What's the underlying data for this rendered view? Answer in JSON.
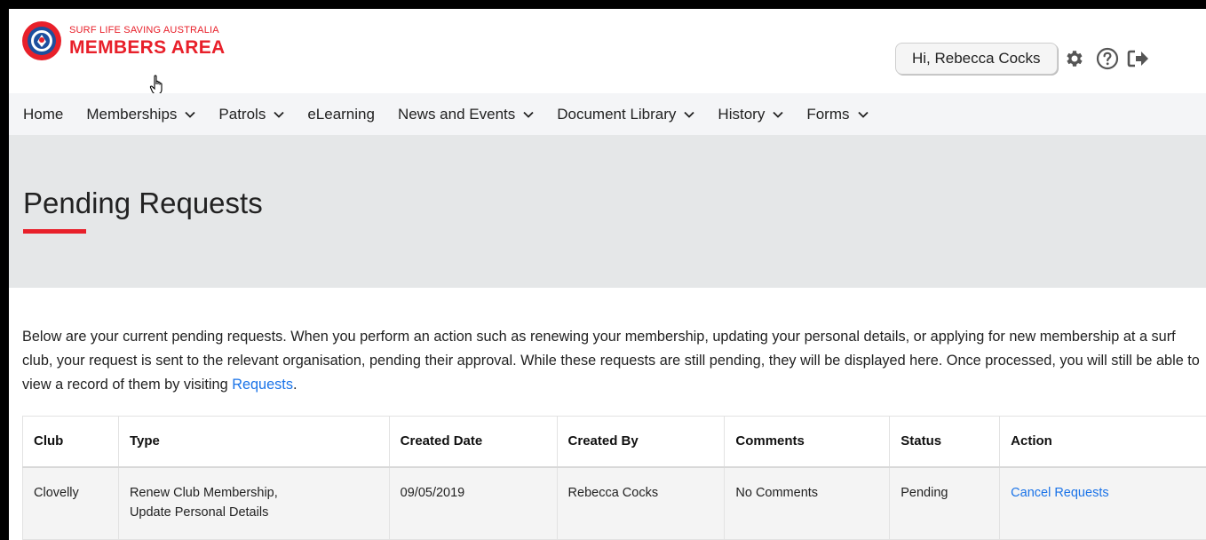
{
  "header": {
    "logo_small": "SURF LIFE SAVING AUSTRALIA",
    "logo_big": "MEMBERS AREA",
    "greeting": "Hi, Rebecca Cocks",
    "icons": [
      "gear-icon",
      "help-icon",
      "logout-icon"
    ]
  },
  "nav": {
    "items": [
      {
        "label": "Home",
        "dropdown": false
      },
      {
        "label": "Memberships",
        "dropdown": true
      },
      {
        "label": "Patrols",
        "dropdown": true
      },
      {
        "label": "eLearning",
        "dropdown": false
      },
      {
        "label": "News and Events",
        "dropdown": true
      },
      {
        "label": "Document Library",
        "dropdown": true
      },
      {
        "label": "History",
        "dropdown": true
      },
      {
        "label": "Forms",
        "dropdown": true
      }
    ]
  },
  "page": {
    "title": "Pending Requests",
    "intro_text": "Below are your current pending requests. When you perform an action such as renewing your membership, updating your personal details, or applying for new membership at a surf club, your request is sent to the relevant organisation, pending their approval. While these requests are still pending, they will be displayed here. Once processed, you will still be able to view a record of them by visiting ",
    "intro_link": "Requests",
    "intro_end": "."
  },
  "table": {
    "headers": [
      "Club",
      "Type",
      "Created Date",
      "Created By",
      "Comments",
      "Status",
      "Action"
    ],
    "rows": [
      {
        "club": "Clovelly",
        "type_line1": "Renew Club Membership,",
        "type_line2": "Update Personal Details",
        "created_date": "09/05/2019",
        "created_by": "Rebecca Cocks",
        "comments": "No Comments",
        "status": "Pending",
        "action": "Cancel Requests"
      }
    ]
  },
  "colors": {
    "brand_red": "#e8202a",
    "link_blue": "#1a73e8",
    "banner_bg": "#e5e7e8",
    "nav_bg": "#f4f5f7"
  }
}
